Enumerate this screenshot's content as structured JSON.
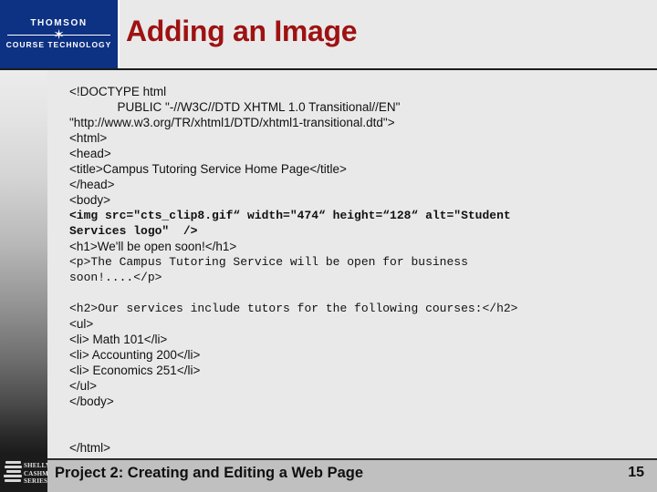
{
  "header": {
    "title": "Adding an Image",
    "title_color": "#9e1212",
    "logo": {
      "top_text": "THOMSON",
      "star_icon": "✶",
      "bottom_text": "COURSE TECHNOLOGY",
      "background_color": "#0d3183"
    }
  },
  "code": {
    "lines": [
      {
        "text": "<!DOCTYPE html",
        "style": "sans"
      },
      {
        "text": "              PUBLIC \"-//W3C//DTD XHTML 1.0 Transitional//EN\"",
        "style": "sans"
      },
      {
        "text": "\"http://www.w3.org/TR/xhtml1/DTD/xhtml1-transitional.dtd\">",
        "style": "sans"
      },
      {
        "text": "<html>",
        "style": "sans"
      },
      {
        "text": "<head>",
        "style": "sans"
      },
      {
        "text": "<title>Campus Tutoring Service Home Page</title>",
        "style": "sans"
      },
      {
        "text": "</head>",
        "style": "sans"
      },
      {
        "text": "<body>",
        "style": "sans"
      },
      {
        "text": "<img src=\"cts_clip8.gif“ width=\"474“ height=“128“ alt=\"Student",
        "style": "mono-bold"
      },
      {
        "text": "Services logo\"  />",
        "style": "mono-bold"
      },
      {
        "text": "<h1>We'll be open soon!</h1>",
        "style": "sans"
      },
      {
        "text": "<p>The Campus Tutoring Service will be open for business",
        "style": "mono"
      },
      {
        "text": "soon!....</p>",
        "style": "mono"
      },
      {
        "text": "",
        "style": "spacer"
      },
      {
        "text": "<h2>Our services include tutors for the following courses:</h2>",
        "style": "mono"
      },
      {
        "text": "<ul>",
        "style": "sans"
      },
      {
        "text": "<li> Math 101</li>",
        "style": "sans"
      },
      {
        "text": "<li> Accounting 200</li>",
        "style": "sans"
      },
      {
        "text": "<li> Economics 251</li>",
        "style": "sans"
      },
      {
        "text": "</ul>",
        "style": "sans"
      },
      {
        "text": "</body>",
        "style": "sans"
      },
      {
        "text": "",
        "style": "spacer"
      },
      {
        "text": "",
        "style": "spacer"
      },
      {
        "text": "</html>",
        "style": "sans"
      }
    ]
  },
  "footer": {
    "title": "Project 2: Creating and Editing a Web Page",
    "page_number": "15",
    "logo": {
      "line1": "SHELLY",
      "line2": "CASHMAN",
      "line3": "SERIES."
    },
    "bar_color": "#c0c0c0"
  }
}
